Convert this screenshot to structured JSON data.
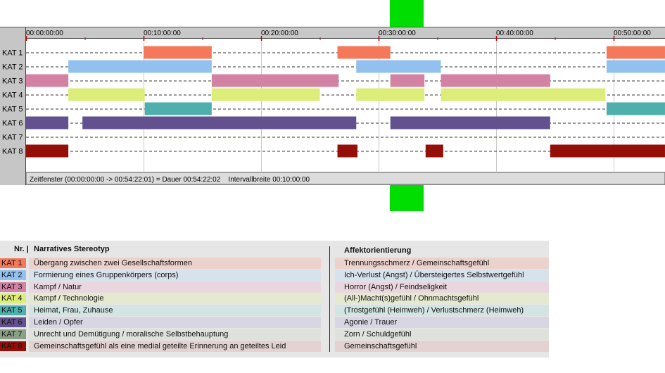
{
  "timeline": {
    "time_labels": [
      "00:00:00:00",
      "00:10:00:00",
      "00:20:00:00",
      "00:30:00:00",
      "00:40:00:00",
      "00:50:00:00"
    ],
    "status_text": "Zeitfenster (00:00:00:00 -> 00:54:22:01) = Dauer 00:54:22:02    Intervallbreite 00:10:00:00"
  },
  "chart_data": {
    "type": "gantt",
    "x_unit": "minutes",
    "xlim": [
      0,
      54.37
    ],
    "tick_interval": 10,
    "categories": [
      "KAT 1",
      "KAT 2",
      "KAT 3",
      "KAT 4",
      "KAT 5",
      "KAT 6",
      "KAT 7",
      "KAT 8"
    ],
    "series": [
      {
        "name": "KAT 1",
        "color": "#f4785a",
        "segments": [
          [
            10.0,
            15.8
          ],
          [
            26.5,
            31.0
          ],
          [
            49.4,
            54.37
          ]
        ]
      },
      {
        "name": "KAT 2",
        "color": "#92c1f0",
        "segments": [
          [
            3.6,
            15.8
          ],
          [
            28.1,
            35.3
          ],
          [
            49.4,
            54.37
          ]
        ]
      },
      {
        "name": "KAT 3",
        "color": "#d382a4",
        "segments": [
          [
            0,
            3.6
          ],
          [
            15.8,
            26.6
          ],
          [
            31.0,
            33.9
          ],
          [
            35.3,
            44.6
          ]
        ]
      },
      {
        "name": "KAT 4",
        "color": "#dced7a",
        "segments": [
          [
            3.6,
            10.1
          ],
          [
            15.8,
            25.0
          ],
          [
            28.1,
            33.9
          ],
          [
            35.3,
            49.3
          ]
        ]
      },
      {
        "name": "KAT 5",
        "color": "#4eafac",
        "segments": [
          [
            10.1,
            15.8
          ],
          [
            49.4,
            54.37
          ]
        ]
      },
      {
        "name": "KAT 6",
        "color": "#62508f",
        "segments": [
          [
            0,
            3.6
          ],
          [
            4.8,
            28.1
          ],
          [
            31.0,
            44.6
          ]
        ]
      },
      {
        "name": "KAT 7",
        "color": "#8aa086",
        "segments": []
      },
      {
        "name": "KAT 8",
        "color": "#940f07",
        "segments": [
          [
            0,
            3.6
          ],
          [
            26.5,
            28.2
          ],
          [
            34.0,
            35.5
          ],
          [
            44.6,
            54.37
          ]
        ]
      }
    ]
  },
  "legend": {
    "header_nr": "Nr. |",
    "header_stereotyp": "Narratives Stereotyp",
    "header_affekt": "Affektorientierung",
    "rows": [
      {
        "kat": "KAT 1",
        "color": "#f4785a",
        "text": "Übergang zwischen zwei Gesellschaftsformen",
        "affekt": "Trennungsschmerz / Gemeinschaftsgefühl",
        "bg": "#ecd2cc"
      },
      {
        "kat": "KAT 2",
        "color": "#92c1f0",
        "text": "Formierung eines Gruppenkörpers (corps)",
        "affekt": "Ich-Verlust (Angst) / Übersteigertes Selbstwertgefühl",
        "bg": "#d7e2ec"
      },
      {
        "kat": "KAT 3",
        "color": "#d382a4",
        "text": "Kampf / Natur",
        "affekt": "Horror (Angst) / Feindseligkeit",
        "bg": "#e9d6de"
      },
      {
        "kat": "KAT 4",
        "color": "#dced7a",
        "text": "Kampf / Technologie",
        "affekt": "(All-)Macht(s)gefühl / Ohnmachtsgefühl",
        "bg": "#e5e9d0"
      },
      {
        "kat": "KAT 5",
        "color": "#4eafac",
        "text": "Heimat, Frau, Zuhause",
        "affekt": "(Trostgefühl (Heimweh) / Verlustschmerz (Heimweh)",
        "bg": "#d2e5e3"
      },
      {
        "kat": "KAT 6",
        "color": "#62508f",
        "text": "Leiden / Opfer",
        "affekt": "Agonie / Trauer",
        "bg": "#d9d6e3"
      },
      {
        "kat": "KAT 7",
        "color": "#8aa086",
        "text": "Unrecht und Demütigung / moralische Selbstbehauptung",
        "affekt": "Zorn / Schuldgefühl",
        "bg": "#dde2dc"
      },
      {
        "kat": "KAT 8",
        "color": "#940f07",
        "text": "Gemeinschaftsgefühl als eine medial geteilte Erinnerung an geteiltes Leid",
        "affekt": "Gemeinschaftsgefühl",
        "bg": "#e3d2d1"
      }
    ]
  }
}
